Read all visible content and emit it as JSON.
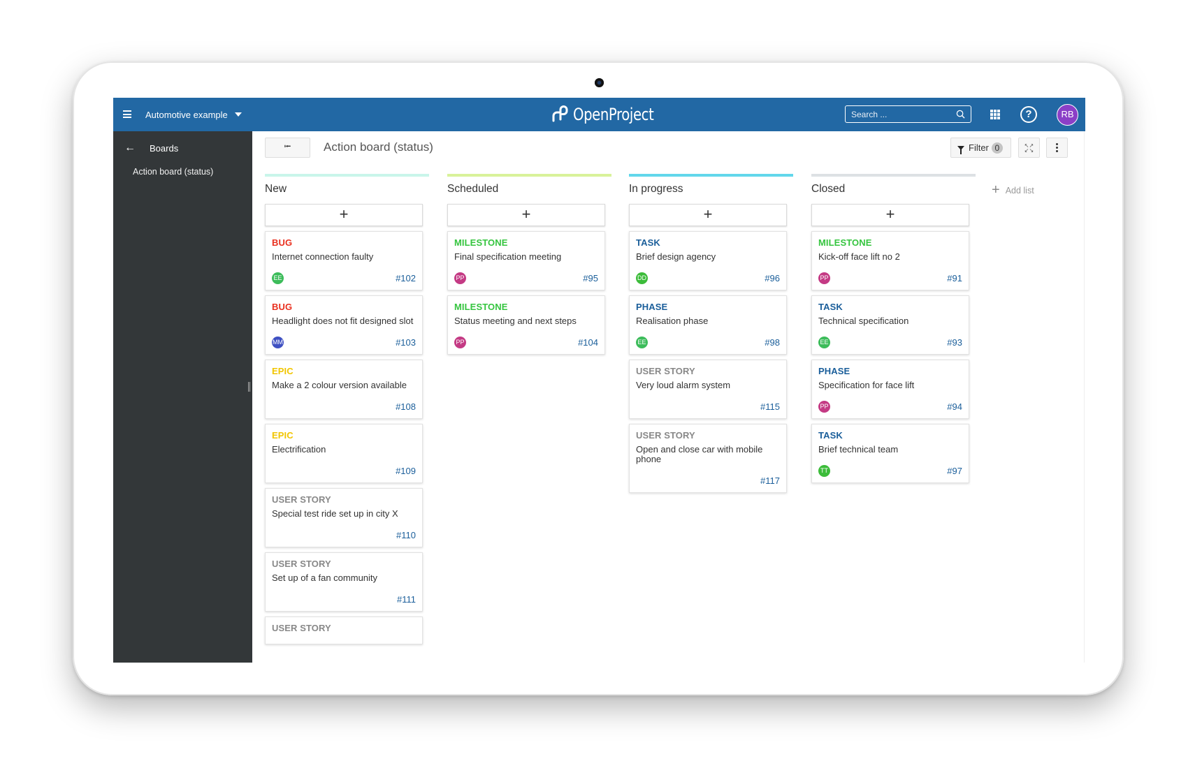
{
  "header": {
    "project_name": "Automotive example",
    "logo_text": "OpenProject",
    "search_placeholder": "Search ...",
    "user_initials": "RB",
    "user_avatar_color": "#8b3fc7",
    "brand_color": "#2268a4"
  },
  "sidebar": {
    "back_label": "Boards",
    "items": [
      {
        "label": "Action board (status)"
      }
    ]
  },
  "toolbar": {
    "back_button": "⭰",
    "title": "Action board (status)",
    "filter_label": "Filter",
    "filter_count": "0"
  },
  "board": {
    "add_card_symbol": "+",
    "add_list_label": "Add list",
    "columns": [
      {
        "title": "New",
        "color": "#c9f5ea",
        "cards": [
          {
            "type": "BUG",
            "type_color": "#e9301f",
            "subject": "Internet connection faulty",
            "assignee": "EE",
            "assignee_color": "#3cbc5a",
            "id": "#102"
          },
          {
            "type": "BUG",
            "type_color": "#e9301f",
            "subject": "Headlight does not fit designed slot",
            "assignee": "MM",
            "assignee_color": "#3e50c2",
            "id": "#103"
          },
          {
            "type": "EPIC",
            "type_color": "#f1c500",
            "subject": "Make a 2 colour version available",
            "assignee": "",
            "assignee_color": "",
            "id": "#108"
          },
          {
            "type": "EPIC",
            "type_color": "#f1c500",
            "subject": "Electrification",
            "assignee": "",
            "assignee_color": "",
            "id": "#109"
          },
          {
            "type": "USER STORY",
            "type_color": "#888888",
            "subject": "Special test ride set up in city X",
            "assignee": "",
            "assignee_color": "",
            "id": "#110"
          },
          {
            "type": "USER STORY",
            "type_color": "#888888",
            "subject": "Set up of a fan community",
            "assignee": "",
            "assignee_color": "",
            "id": "#111"
          },
          {
            "type": "USER STORY",
            "type_color": "#888888",
            "subject": "",
            "assignee": "",
            "assignee_color": "",
            "id": ""
          }
        ]
      },
      {
        "title": "Scheduled",
        "color": "#d9f29a",
        "cards": [
          {
            "type": "MILESTONE",
            "type_color": "#35c53f",
            "subject": "Final specification meeting",
            "assignee": "PP",
            "assignee_color": "#c43a84",
            "id": "#95"
          },
          {
            "type": "MILESTONE",
            "type_color": "#35c53f",
            "subject": "Status meeting and next steps",
            "assignee": "PP",
            "assignee_color": "#c43a84",
            "id": "#104"
          }
        ]
      },
      {
        "title": "In progress",
        "color": "#62d7eb",
        "cards": [
          {
            "type": "TASK",
            "type_color": "#1a5e9a",
            "subject": "Brief design agency",
            "assignee": "DD",
            "assignee_color": "#3cbc3a",
            "id": "#96"
          },
          {
            "type": "PHASE",
            "type_color": "#1a5e9a",
            "subject": "Realisation phase",
            "assignee": "EE",
            "assignee_color": "#3cbc5a",
            "id": "#98"
          },
          {
            "type": "USER STORY",
            "type_color": "#888888",
            "subject": "Very loud alarm system",
            "assignee": "",
            "assignee_color": "",
            "id": "#115"
          },
          {
            "type": "USER STORY",
            "type_color": "#888888",
            "subject": "Open and close car with mobile phone",
            "assignee": "",
            "assignee_color": "",
            "id": "#117"
          }
        ]
      },
      {
        "title": "Closed",
        "color": "#dde1e4",
        "cards": [
          {
            "type": "MILESTONE",
            "type_color": "#35c53f",
            "subject": "Kick-off face lift no 2",
            "assignee": "PP",
            "assignee_color": "#c43a84",
            "id": "#91"
          },
          {
            "type": "TASK",
            "type_color": "#1a5e9a",
            "subject": "Technical specification",
            "assignee": "EE",
            "assignee_color": "#3cbc5a",
            "id": "#93"
          },
          {
            "type": "PHASE",
            "type_color": "#1a5e9a",
            "subject": "Specification for face lift",
            "assignee": "PP",
            "assignee_color": "#c43a84",
            "id": "#94"
          },
          {
            "type": "TASK",
            "type_color": "#1a5e9a",
            "subject": "Brief technical team",
            "assignee": "TT",
            "assignee_color": "#3cbc3a",
            "id": "#97"
          }
        ]
      }
    ]
  }
}
